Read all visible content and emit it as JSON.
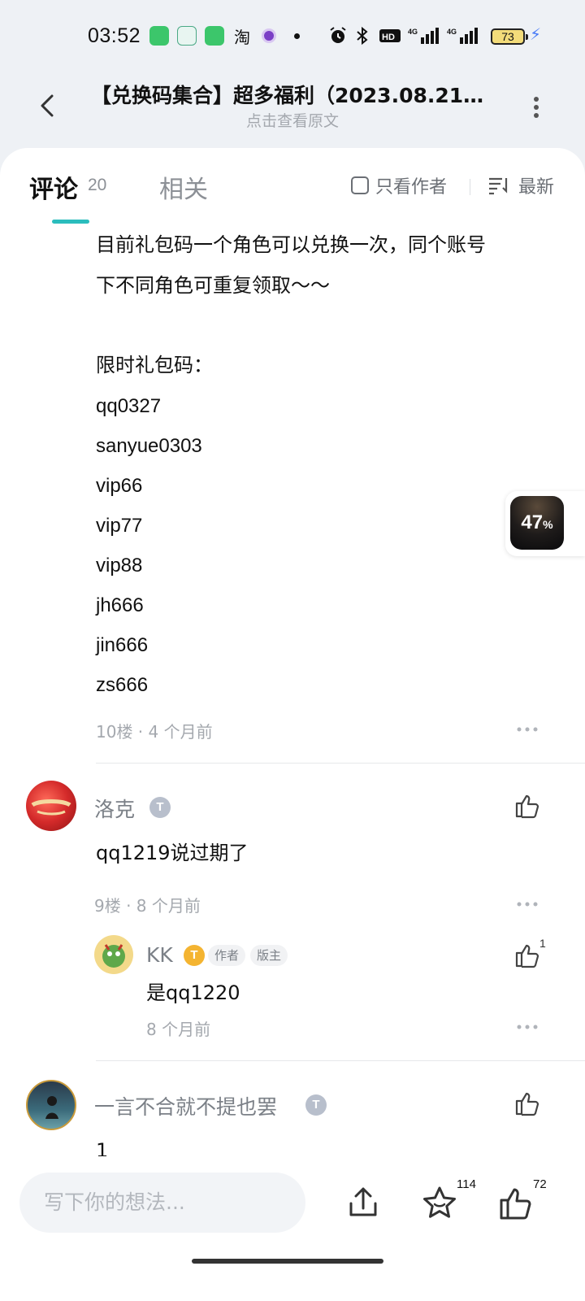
{
  "status_bar": {
    "time": "03:52",
    "taobao_glyph": "淘",
    "battery": "73",
    "icons": [
      "app-green-icon",
      "home-app-icon",
      "message-app-icon",
      "taobao-icon",
      "purple-app-icon",
      "dot-icon",
      "alarm-icon",
      "bluetooth-icon",
      "hd-icon",
      "signal-4g-icon",
      "signal-4g-icon",
      "battery-icon",
      "charging-icon"
    ]
  },
  "header": {
    "title": "【兑换码集合】超多福利（2023.08.21…",
    "subtitle": "点击查看原文"
  },
  "tabs": {
    "comments_label": "评论",
    "comments_count": "20",
    "related_label": "相关",
    "author_only_label": "只看作者",
    "sort_label": "最新"
  },
  "post": {
    "intro_line1": "目前礼包码一个角色可以兑换一次，同个账号",
    "intro_line2": "下不同角色可重复领取～～",
    "codes_heading": "限时礼包码：",
    "codes": [
      "qq0327",
      "sanyue0303",
      "vip66",
      "vip77",
      "vip88",
      "jh666",
      "jin666",
      "zs666"
    ],
    "meta": "10楼 · 4 个月前"
  },
  "comments": [
    {
      "username": "洛克",
      "level": "T",
      "text": "qq1219说过期了",
      "meta": "9楼 · 8 个月前",
      "reply": {
        "username": "KK",
        "level": "T",
        "tags": [
          "作者",
          "版主"
        ],
        "text": "是qq1220",
        "meta": "8 个月前",
        "likes": "1"
      }
    },
    {
      "username": "一言不合就不提也罢",
      "level": "T",
      "text": "1"
    }
  ],
  "floating_widget": {
    "percent": "47",
    "percent_sign": "%"
  },
  "bottom_bar": {
    "input_placeholder": "写下你的想法...",
    "favorite_count": "114",
    "like_count": "72"
  },
  "colors": {
    "accent": "#2bbdbd",
    "background": "#eef1f5",
    "muted_text": "#a4a8ae"
  }
}
